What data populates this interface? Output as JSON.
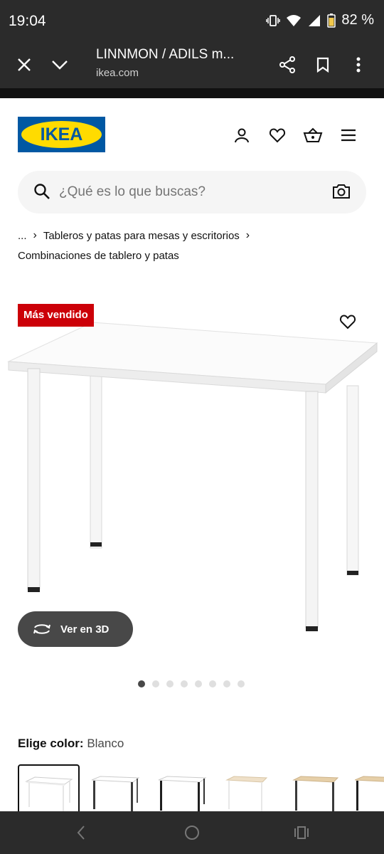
{
  "status_bar": {
    "time": "19:04",
    "battery": "82 %"
  },
  "browser": {
    "title": "LINNMON / ADILS m...",
    "url": "ikea.com"
  },
  "header": {
    "logo_text": "IKEA"
  },
  "search": {
    "placeholder": "¿Qué es lo que buscas?"
  },
  "breadcrumb": {
    "ellipsis": "...",
    "level1": "Tableros y patas para mesas y escritorios",
    "level2": "Combinaciones de tablero y patas"
  },
  "product": {
    "badge": "Más vendido",
    "view_3d_label": "Ver en 3D",
    "image_count": 8,
    "active_image": 1
  },
  "color": {
    "label": "Elige color:",
    "value": "Blanco",
    "options": [
      {
        "top": "#ffffff",
        "legs": "#ffffff"
      },
      {
        "top": "#ffffff",
        "legs": "#3a3a3a"
      },
      {
        "top": "#ffffff",
        "legs": "#1f1f1f"
      },
      {
        "top": "#efe0c8",
        "legs": "#ffffff"
      },
      {
        "top": "#e6cfa8",
        "legs": "#3a3a3a"
      },
      {
        "top": "#e6cfa8",
        "legs": "#1f1f1f"
      }
    ]
  },
  "colors": {
    "brand_blue": "#0058a3",
    "brand_yellow": "#ffdb00",
    "badge_red": "#cc0008"
  }
}
